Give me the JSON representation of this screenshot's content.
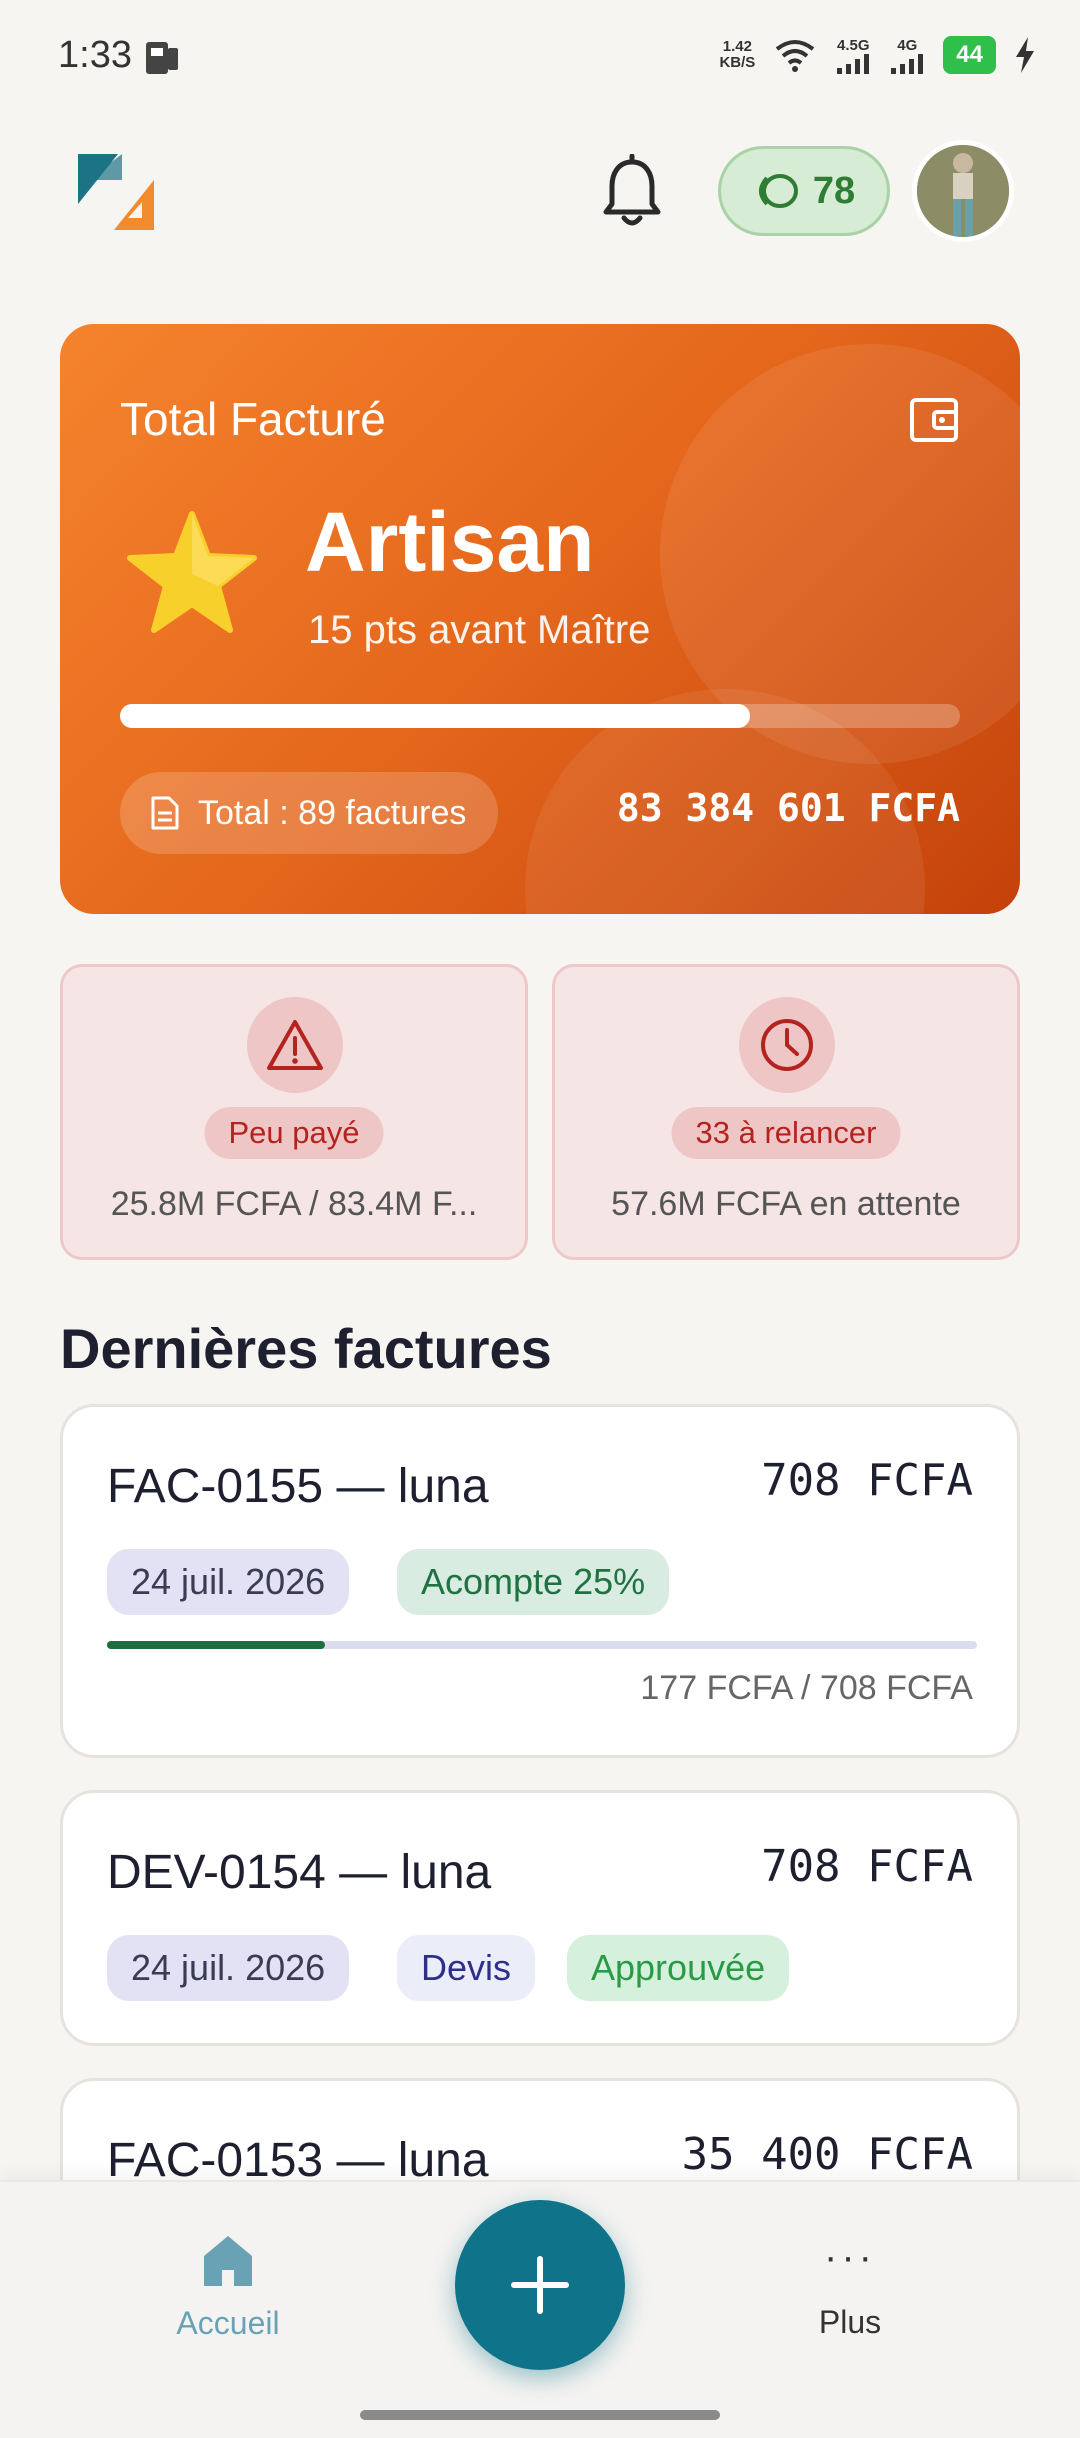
{
  "status_bar": {
    "time": "1:33",
    "net_speed_top": "1.42",
    "net_speed_bottom": "KB/S",
    "net1": "4.5G",
    "net2": "4G",
    "battery": "44"
  },
  "header": {
    "points": "78",
    "logo_icon": "app-logo-icon",
    "bell_icon": "bell-icon",
    "points_icon": "coin-icon"
  },
  "hero": {
    "title": "Total Facturé",
    "level": "Artisan",
    "subtitle": "15 pts avant Maître",
    "progress": 0.75,
    "total_label": "Total : 89 factures",
    "amount": "83 384 601 FCFA",
    "colors": {
      "start": "#f5832d",
      "end": "#c4420a"
    }
  },
  "stats": {
    "paid": {
      "badge": "Peu payé",
      "text": "25.8M FCFA / 83.4M F...",
      "icon": "warning-icon"
    },
    "pending": {
      "badge": "33 à relancer",
      "text": "57.6M FCFA en attente",
      "icon": "clock-icon"
    }
  },
  "section_title": "Dernières factures",
  "invoices": [
    {
      "title": "FAC-0155 — luna",
      "amount": "708 FCFA",
      "date": "24 juil. 2026",
      "tag": "Acompte 25%",
      "progress": 0.25,
      "progress_text": "177 FCFA / 708 FCFA"
    },
    {
      "title": "DEV-0154 — luna",
      "amount": "708 FCFA",
      "date": "24 juil. 2026",
      "type": "Devis",
      "status": "Approuvée"
    },
    {
      "title": "FAC-0153 — luna",
      "amount": "35 400 FCFA"
    }
  ],
  "nav": {
    "home": "Accueil",
    "more": "Plus",
    "more_dots": "···",
    "accent": "#0f7489"
  }
}
